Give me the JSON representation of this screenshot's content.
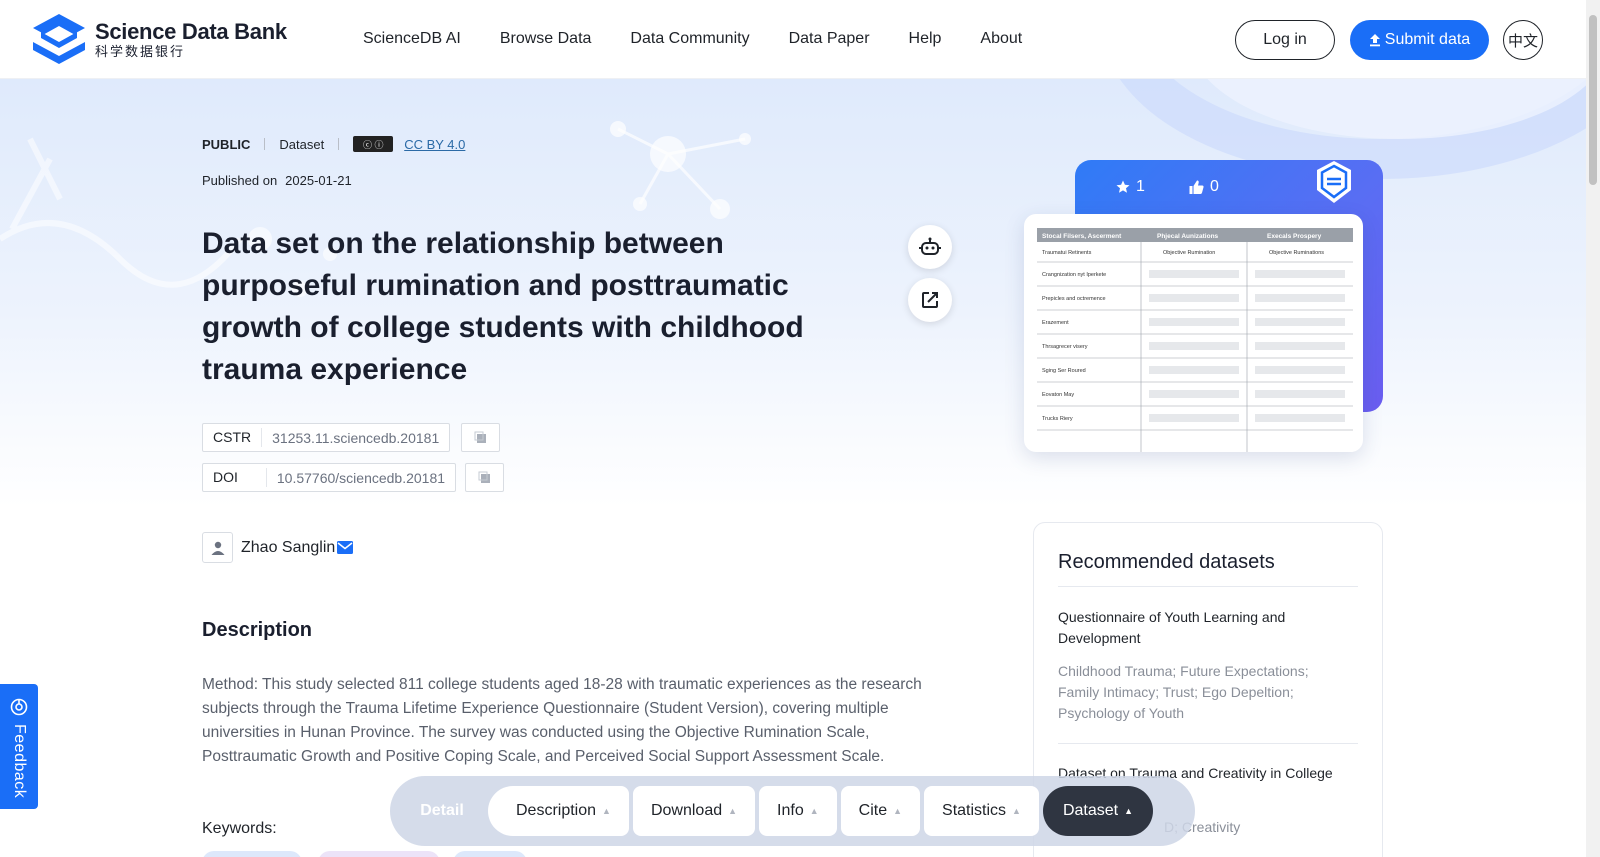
{
  "header": {
    "logo_en": "Science Data Bank",
    "logo_cn": "科学数据银行",
    "nav": [
      "ScienceDB AI",
      "Browse Data",
      "Data Community",
      "Data Paper",
      "Help",
      "About"
    ],
    "login": "Log in",
    "submit": "Submit data",
    "lang": "中文"
  },
  "dataset": {
    "visibility": "PUBLIC",
    "type": "Dataset",
    "license": "CC BY 4.0",
    "published_label": "Published on",
    "published_date": "2025-01-21",
    "title": "Data set on the relationship between purposeful rumination and posttraumatic growth of college students with childhood trauma experience",
    "cstr_label": "CSTR",
    "cstr_value": "31253.11.sciencedb.20181",
    "doi_label": "DOI",
    "doi_value": "10.57760/sciencedb.20181",
    "author": "Zhao Sanglin",
    "stars": "1",
    "likes": "0"
  },
  "description": {
    "heading": "Description",
    "text": "Method: This study selected 811 college students aged 18-28 with traumatic experiences as the research subjects through the Trauma Lifetime Experience Questionnaire (Student Version), covering multiple universities in Hunan Province. The survey was conducted using the Objective Rumination Scale, Posttraumatic Growth and Positive Coping Scale, and Perceived Social Support Assessment Scale.",
    "keywords_label": "Keywords:"
  },
  "recommended": {
    "heading": "Recommended datasets",
    "items": [
      {
        "title": "Questionnaire of Youth Learning and Development",
        "keywords": "Childhood Trauma; Future Expectations; Family Intimacy; Trust; Ego Depeltion; Psychology of Youth"
      },
      {
        "title": "Dataset on Trauma and Creativity in College",
        "keywords": "D; Creativity"
      }
    ]
  },
  "feedback": "Feedback",
  "tabbar": {
    "detail": "Detail",
    "tabs": [
      "Description",
      "Download",
      "Info",
      "Cite",
      "Statistics",
      "Dataset"
    ]
  },
  "preview_table": {
    "headers": [
      "Stocal Filsers, Ascerment",
      "Phjecal Aunizations",
      "Execals Prospery"
    ],
    "sub_left": "Traumatui Retinents",
    "sub_mid": "Objective Rumination",
    "sub_right": "Objective Ruminations",
    "rows": [
      "Crangnization nyt Iperkete",
      "Prepicles and octremence",
      "Erazement",
      "Thrsagrecer visery",
      "Sging Ser Roured",
      "Eovaton May",
      "Trucks Riery"
    ]
  },
  "colors": {
    "accent": "#1a6ef7",
    "card_gradient_start": "#2f7bf6",
    "card_gradient_end": "#6b5df0",
    "dark_tab": "#2f3541"
  }
}
